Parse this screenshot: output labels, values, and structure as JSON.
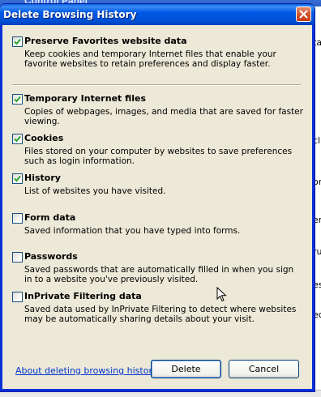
{
  "background_window": {
    "title": "Control Panel",
    "fragments": [
      "tar",
      "cl",
      "or",
      "er",
      "ru",
      "es",
      "ec"
    ]
  },
  "dialog": {
    "title": "Delete Browsing History",
    "close_icon": "close-x-icon",
    "items": [
      {
        "label": "Preserve Favorites website data",
        "checked": true,
        "description": "Keep cookies and temporary Internet files that enable your favorite websites to retain preferences and display faster."
      },
      {
        "label": "Temporary Internet files",
        "checked": true,
        "description": "Copies of webpages, images, and media that are saved for faster viewing."
      },
      {
        "label": "Cookies",
        "checked": true,
        "description": "Files stored on your computer by websites to save preferences such as login information."
      },
      {
        "label": "History",
        "checked": true,
        "description": "List of websites you have visited."
      },
      {
        "label": "Form data",
        "checked": false,
        "description": "Saved information that you have typed into forms."
      },
      {
        "label": "Passwords",
        "checked": false,
        "description": "Saved passwords that are automatically filled in when you sign in to a website you've previously visited."
      },
      {
        "label": "InPrivate Filtering data",
        "checked": false,
        "description": "Saved data used by InPrivate Filtering to detect where websites may be automatically sharing details about your visit."
      }
    ],
    "link_text": "About deleting browsing history",
    "delete_label": "Delete",
    "cancel_label": "Cancel"
  },
  "colors": {
    "title_blue": "#0058e6",
    "dialog_face": "#ece9d8",
    "check_green": "#21a121",
    "link_blue": "#0033cc",
    "close_red": "#d3542d"
  }
}
